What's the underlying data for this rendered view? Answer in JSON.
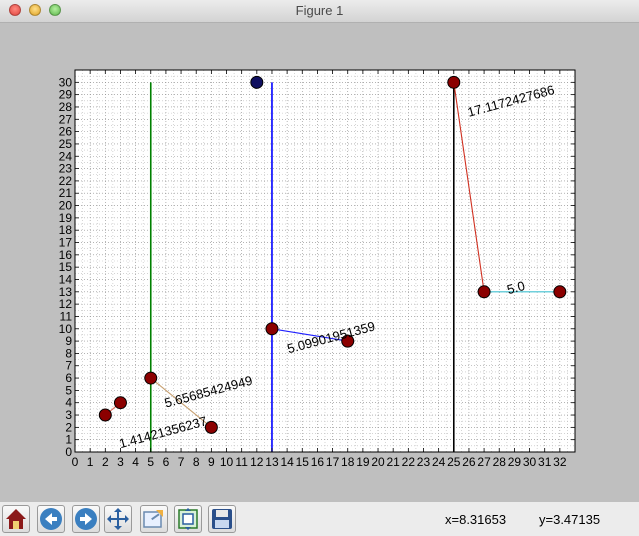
{
  "window": {
    "title": "Figure 1"
  },
  "toolbar": {
    "buttons": [
      {
        "name": "home-button",
        "icon": "home-icon"
      },
      {
        "name": "back-button",
        "icon": "arrow-left-icon"
      },
      {
        "name": "forward-button",
        "icon": "arrow-right-icon"
      },
      {
        "name": "pan-button",
        "icon": "move-arrows-icon"
      },
      {
        "name": "zoom-button",
        "icon": "zoom-rect-icon"
      },
      {
        "name": "subplots-button",
        "icon": "subplots-icon"
      },
      {
        "name": "save-button",
        "icon": "floppy-disk-icon"
      }
    ],
    "x_readout": "x=8.31653",
    "y_readout": "y=3.47135"
  },
  "chart_data": {
    "type": "line",
    "title": "",
    "xlabel": "",
    "ylabel": "",
    "xlim": [
      0,
      33
    ],
    "ylim": [
      0,
      31
    ],
    "xticks": [
      0,
      1,
      2,
      3,
      4,
      5,
      6,
      7,
      8,
      9,
      10,
      11,
      12,
      13,
      14,
      15,
      16,
      17,
      18,
      19,
      20,
      21,
      22,
      23,
      24,
      25,
      26,
      27,
      28,
      29,
      30,
      31,
      32
    ],
    "yticks": [
      0,
      1,
      2,
      3,
      4,
      5,
      6,
      7,
      8,
      9,
      10,
      11,
      12,
      13,
      14,
      15,
      16,
      17,
      18,
      19,
      20,
      21,
      22,
      23,
      24,
      25,
      26,
      27,
      28,
      29,
      30
    ],
    "grid": true,
    "grid_style": "dotted",
    "minor_grid": true,
    "segments": [
      {
        "x": [
          2,
          3
        ],
        "y": [
          3,
          4
        ],
        "color": "#e07060"
      },
      {
        "x": [
          5,
          9
        ],
        "y": [
          6,
          2
        ],
        "color": "#c8a070"
      },
      {
        "x": [
          13,
          18
        ],
        "y": [
          10,
          9
        ],
        "color": "#2020ff"
      },
      {
        "x": [
          25,
          27
        ],
        "y": [
          30,
          13
        ],
        "color": "#d03020"
      },
      {
        "x": [
          27,
          32
        ],
        "y": [
          13,
          13
        ],
        "color": "#40c0d0"
      }
    ],
    "vlines": [
      {
        "x": 5,
        "y": [
          0,
          30
        ],
        "color": "#008000"
      },
      {
        "x": 13,
        "y": [
          0,
          30
        ],
        "color": "#0000ff"
      },
      {
        "x": 25,
        "y": [
          0,
          30
        ],
        "color": "#000000"
      }
    ],
    "points": [
      {
        "x": 2,
        "y": 3,
        "color": "#8b0000"
      },
      {
        "x": 3,
        "y": 4,
        "color": "#8b0000"
      },
      {
        "x": 5,
        "y": 6,
        "color": "#8b0000"
      },
      {
        "x": 9,
        "y": 2,
        "color": "#8b0000"
      },
      {
        "x": 13,
        "y": 10,
        "color": "#8b0000"
      },
      {
        "x": 18,
        "y": 9,
        "color": "#8b0000"
      },
      {
        "x": 25,
        "y": 30,
        "color": "#8b0000"
      },
      {
        "x": 27,
        "y": 13,
        "color": "#8b0000"
      },
      {
        "x": 32,
        "y": 13,
        "color": "#8b0000"
      },
      {
        "x": 12,
        "y": 30,
        "color": "#101060"
      }
    ],
    "annotations": [
      {
        "text": "1.41421356237",
        "x": 3.0,
        "y": 0.3,
        "rotation": -15
      },
      {
        "text": "5.65685424949",
        "x": 6.0,
        "y": 3.6,
        "rotation": -15
      },
      {
        "text": "5.09901951359",
        "x": 14.1,
        "y": 8.0,
        "rotation": -15
      },
      {
        "text": "17.1172427686",
        "x": 26.0,
        "y": 27.2,
        "rotation": -15
      },
      {
        "text": "5.0",
        "x": 28.6,
        "y": 12.8,
        "rotation": -15
      }
    ]
  }
}
